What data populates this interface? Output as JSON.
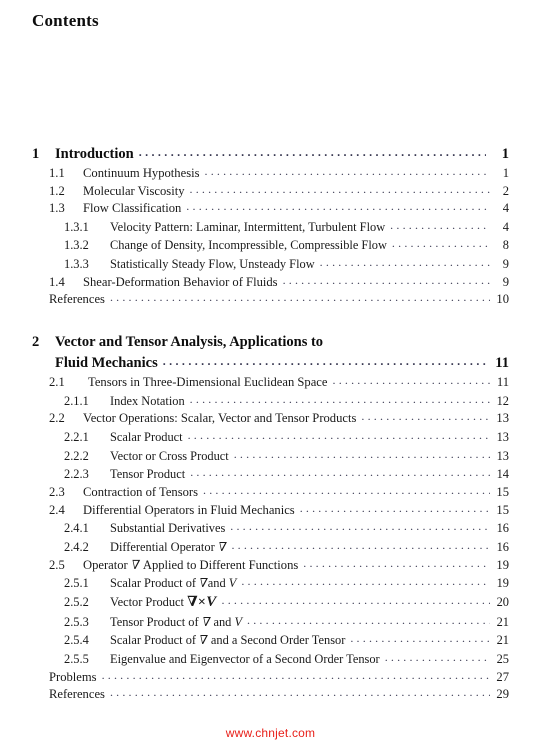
{
  "page": {
    "heading": "Contents",
    "watermark": "www.chnjet.com",
    "watermark_color": "#e8201a",
    "text_color": "#1a1a1a",
    "background_color": "#ffffff"
  },
  "toc": {
    "chapters": [
      {
        "number": "1",
        "title": "Introduction",
        "title_lines": [
          "Introduction"
        ],
        "page": "1",
        "entries": [
          {
            "level": 2,
            "number": "1.1",
            "label": "Continuum Hypothesis",
            "page": "1"
          },
          {
            "level": 2,
            "number": "1.2",
            "label": "Molecular Viscosity",
            "page": "2"
          },
          {
            "level": 2,
            "number": "1.3",
            "label": "Flow Classification",
            "page": "4"
          },
          {
            "level": 3,
            "number": "1.3.1",
            "label": "Velocity Pattern: Laminar, Intermittent, Turbulent Flow",
            "page": "4"
          },
          {
            "level": 3,
            "number": "1.3.2",
            "label": "Change of Density, Incompressible, Compressible Flow",
            "page": "8"
          },
          {
            "level": 3,
            "number": "1.3.3",
            "label": "Statistically Steady Flow, Unsteady Flow",
            "page": "9"
          },
          {
            "level": 2,
            "number": "1.4",
            "label": "Shear-Deformation Behavior of Fluids",
            "page": "9"
          },
          {
            "level": 0,
            "number": "",
            "label": "References",
            "page": "10"
          }
        ]
      },
      {
        "number": "2",
        "title": "Vector and Tensor Analysis, Applications to Fluid Mechanics",
        "title_lines": [
          "Vector and Tensor Analysis, Applications to",
          "Fluid Mechanics"
        ],
        "page": "11",
        "entries": [
          {
            "level": 2,
            "number": "2.1",
            "label": "Tensors in Three-Dimensional Euclidean Space",
            "page": "11",
            "wide": true
          },
          {
            "level": 3,
            "number": "2.1.1",
            "label": "Index Notation",
            "page": "12"
          },
          {
            "level": 2,
            "number": "2.2",
            "label": "Vector Operations: Scalar, Vector and Tensor Products",
            "page": "13"
          },
          {
            "level": 3,
            "number": "2.2.1",
            "label": "Scalar Product",
            "page": "13"
          },
          {
            "level": 3,
            "number": "2.2.2",
            "label": "Vector or Cross Product",
            "page": "13"
          },
          {
            "level": 3,
            "number": "2.2.3",
            "label": "Tensor Product",
            "page": "14"
          },
          {
            "level": 2,
            "number": "2.3",
            "label": "Contraction of Tensors",
            "page": "15"
          },
          {
            "level": 2,
            "number": "2.4",
            "label": "Differential Operators in Fluid Mechanics",
            "page": "15"
          },
          {
            "level": 3,
            "number": "2.4.1",
            "label": "Substantial Derivatives",
            "page": "16"
          },
          {
            "level": 3,
            "number": "2.4.2",
            "label": "Differential Operator ∇",
            "page": "16",
            "math": "nabla-suffix"
          },
          {
            "level": 2,
            "number": "2.5",
            "label": "Operator ∇ Applied to Different Functions",
            "page": "19",
            "math": "nabla-inline"
          },
          {
            "level": 3,
            "number": "2.5.1",
            "label": "Scalar Product of ∇and V",
            "page": "19",
            "math": "nabla-v-thin"
          },
          {
            "level": 3,
            "number": "2.5.2",
            "label": "Vector Product ∇×V",
            "page": "20",
            "math": "nabla-cross-v-bold"
          },
          {
            "level": 3,
            "number": "2.5.3",
            "label": "Tensor Product of ∇ and V",
            "page": "21",
            "math": "nabla-and-v"
          },
          {
            "level": 3,
            "number": "2.5.4",
            "label": "Scalar Product of ∇ and a Second Order Tensor",
            "page": "21",
            "math": "nabla-mid"
          },
          {
            "level": 3,
            "number": "2.5.5",
            "label": "Eigenvalue and Eigenvector of a Second Order Tensor",
            "page": "25"
          },
          {
            "level": 0,
            "number": "",
            "label": "Problems",
            "page": "27"
          },
          {
            "level": 0,
            "number": "",
            "label": "References",
            "page": "29"
          }
        ]
      }
    ]
  }
}
